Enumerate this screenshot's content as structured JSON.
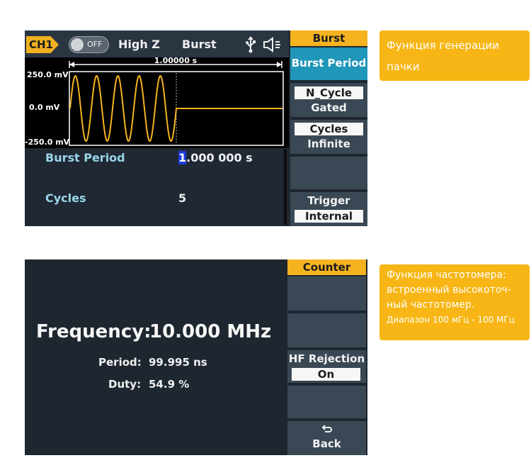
{
  "screen1": {
    "channel": "CH1",
    "output_state": "OFF",
    "load": "High Z",
    "mode": "Burst",
    "time_span": "1.00000 s",
    "y_labels": [
      "250.0 mV",
      "0.0 mV",
      "-250.0 mV"
    ],
    "params": [
      {
        "label": "Burst Period",
        "value_cursor": "1",
        "value_rest": ".000 000 s"
      },
      {
        "label": "",
        "value_cursor": "",
        "value_rest": ""
      },
      {
        "label": "Cycles",
        "value_cursor": "",
        "value_rest": "5"
      },
      {
        "label": "",
        "value_cursor": "",
        "value_rest": ""
      }
    ],
    "sidebar": {
      "title": "Burst",
      "active": "Burst Period",
      "ncycle_boxed": "N_Cycle",
      "ncycle_sub": "Gated",
      "cycles_boxed": "Cycles",
      "cycles_sub": "Infinite",
      "trigger": "Trigger",
      "trigger_boxed": "Internal"
    },
    "colors": {
      "waveform": "#f5b320",
      "active_button": "#2096b8",
      "cursor": "#1c3bd8"
    }
  },
  "screen2": {
    "freq_label": "Frequency:",
    "freq_value": "10.000 MHz",
    "period_label": "Period:",
    "period_value": "99.995 ns",
    "duty_label": "Duty:",
    "duty_value": "54.9 %",
    "sidebar": {
      "title": "Counter",
      "hf_label": "HF Rejection",
      "hf_value": "On",
      "back_icon": "return-icon",
      "back_label": "Back"
    }
  },
  "captions": {
    "caption1": "Функция генерации пачки",
    "caption2_main": "Функция частотомера: встроенный высокоточ-ный частотомер.",
    "caption2_small": "Диапазон 100 мГц - 100 МГц"
  }
}
